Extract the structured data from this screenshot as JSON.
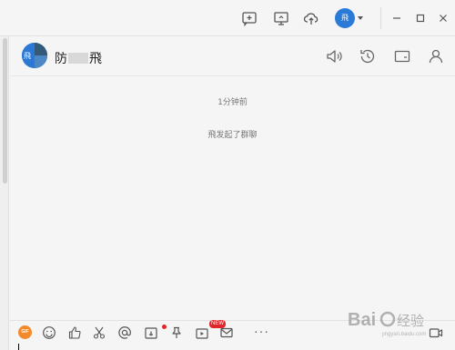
{
  "topbar": {
    "icons": [
      "add-chat-icon",
      "screen-share-icon",
      "cloud-upload-icon"
    ],
    "user_avatar_text": "飛",
    "window_controls": [
      "minimize-icon",
      "maximize-icon",
      "close-icon"
    ]
  },
  "chat": {
    "group_avatar_text": "飛",
    "name_left": "防",
    "name_right": "飛",
    "header_icons": [
      "speaker-icon",
      "history-icon",
      "folder-icon",
      "members-icon"
    ]
  },
  "messages": {
    "time": "1分钟前",
    "system": "飛发起了群聊"
  },
  "toolbar": {
    "gif_label": "GIF",
    "new_badge": "NEW",
    "more_label": "···",
    "tools": [
      "emoji-icon",
      "thumbs-up-icon",
      "scissors-icon",
      "at-icon",
      "share-screen-icon",
      "pin-icon",
      "video-icon",
      "mail-icon",
      "video-call-icon"
    ]
  },
  "watermark": {
    "text": "Bai 经验",
    "subtext": "jingyan.baidu.com"
  },
  "colors": {
    "accent": "#2a7ad8",
    "alert": "#e0262b",
    "gif": "#f28a2b"
  }
}
